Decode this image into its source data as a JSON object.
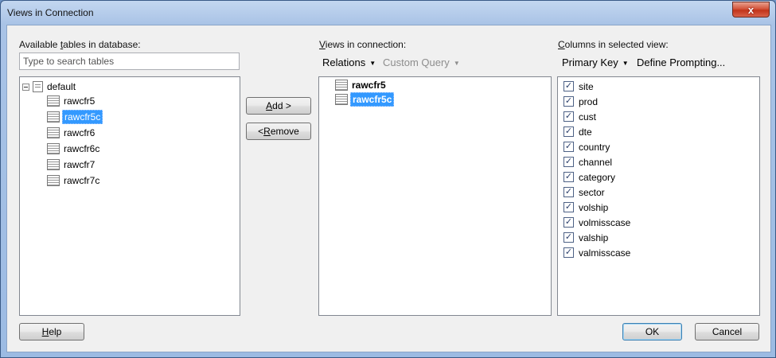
{
  "window": {
    "title": "Views in Connection",
    "close_glyph": "x"
  },
  "available": {
    "label_accel": "t",
    "label_pre": "Available ",
    "label_post": "ables in database:",
    "search_placeholder": "Type to search tables",
    "root": "default",
    "tables": [
      "rawcfr5",
      "rawcfr5c",
      "rawcfr6",
      "rawcfr6c",
      "rawcfr7",
      "rawcfr7c"
    ],
    "selected": "rawcfr5c"
  },
  "buttons": {
    "add_accel": "A",
    "add_rest": "dd >",
    "remove_pre": "< ",
    "remove_accel": "R",
    "remove_rest": "emove",
    "help_accel": "H",
    "help_rest": "elp",
    "ok": "OK",
    "cancel": "Cancel"
  },
  "views": {
    "label_accel": "V",
    "label_rest": "iews in connection:",
    "relations": "Relations",
    "custom_query": "Custom Query",
    "items": [
      "rawcfr5",
      "rawcfr5c"
    ],
    "selected": "rawcfr5c"
  },
  "columns": {
    "label_accel": "C",
    "label_rest": "olumns in selected view:",
    "primary_key": "Primary Key",
    "define_prompting": "Define Prompting...",
    "check_glyph": "✓",
    "items": [
      "site",
      "prod",
      "cust",
      "dte",
      "country",
      "channel",
      "category",
      "sector",
      "volship",
      "volmisscase",
      "valship",
      "valmisscase"
    ]
  }
}
